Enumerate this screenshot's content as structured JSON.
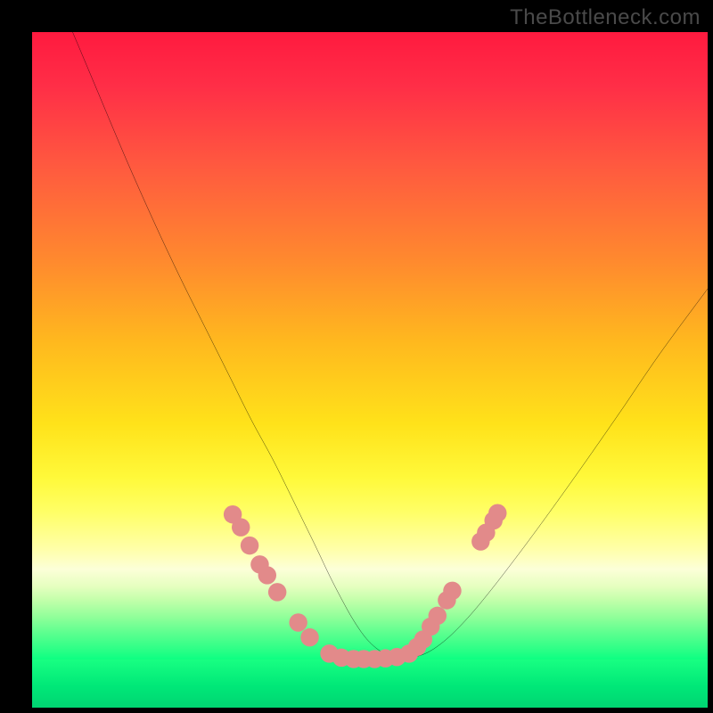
{
  "watermark": "TheBottleneck.com",
  "chart_data": {
    "type": "line",
    "title": "",
    "xlabel": "",
    "ylabel": "",
    "xlim": [
      0,
      100
    ],
    "ylim": [
      0,
      100
    ],
    "grid": false,
    "legend": false,
    "background": {
      "style": "vertical-gradient",
      "top_color": "#ff1a3f",
      "mid_color": "#ffe21a",
      "bottom_color": "#00d874"
    },
    "series": [
      {
        "name": "bottleneck-curve",
        "color": "#000000",
        "x": [
          6,
          10,
          14,
          18,
          22,
          26,
          29.5,
          32.5,
          35.5,
          38,
          40.2,
          42.2,
          44,
          45.8,
          47.6,
          49.5,
          51.5,
          53.5,
          55.8,
          58.4,
          61.3,
          64.5,
          68,
          72,
          76.5,
          81.5,
          87,
          93,
          100
        ],
        "y": [
          100,
          90.5,
          81,
          72,
          63.5,
          55.5,
          48.5,
          42.5,
          37,
          32,
          27.5,
          23.4,
          19.6,
          16.1,
          12.9,
          10.2,
          8.4,
          7.5,
          7.4,
          8.1,
          10.1,
          13.3,
          17.5,
          22.7,
          28.8,
          35.8,
          43.7,
          52.5,
          62
        ]
      }
    ],
    "markers": {
      "name": "highlighted-points",
      "color": "#e28a8a",
      "radius": 1.35,
      "points": [
        {
          "x": 29.7,
          "y": 28.6
        },
        {
          "x": 30.9,
          "y": 26.7
        },
        {
          "x": 32.2,
          "y": 24.0
        },
        {
          "x": 33.7,
          "y": 21.2
        },
        {
          "x": 34.8,
          "y": 19.6
        },
        {
          "x": 36.3,
          "y": 17.1
        },
        {
          "x": 39.4,
          "y": 12.6
        },
        {
          "x": 41.1,
          "y": 10.4
        },
        {
          "x": 44.0,
          "y": 8.0
        },
        {
          "x": 45.8,
          "y": 7.4
        },
        {
          "x": 47.6,
          "y": 7.2
        },
        {
          "x": 49.1,
          "y": 7.2
        },
        {
          "x": 50.7,
          "y": 7.2
        },
        {
          "x": 52.3,
          "y": 7.3
        },
        {
          "x": 54.0,
          "y": 7.5
        },
        {
          "x": 55.8,
          "y": 8.0
        },
        {
          "x": 57.0,
          "y": 9.0
        },
        {
          "x": 57.9,
          "y": 10.1
        },
        {
          "x": 59.0,
          "y": 12.0
        },
        {
          "x": 60.0,
          "y": 13.6
        },
        {
          "x": 61.4,
          "y": 15.9
        },
        {
          "x": 62.2,
          "y": 17.3
        },
        {
          "x": 66.4,
          "y": 24.6
        },
        {
          "x": 67.2,
          "y": 25.9
        },
        {
          "x": 68.3,
          "y": 27.7
        },
        {
          "x": 68.9,
          "y": 28.8
        }
      ]
    }
  }
}
